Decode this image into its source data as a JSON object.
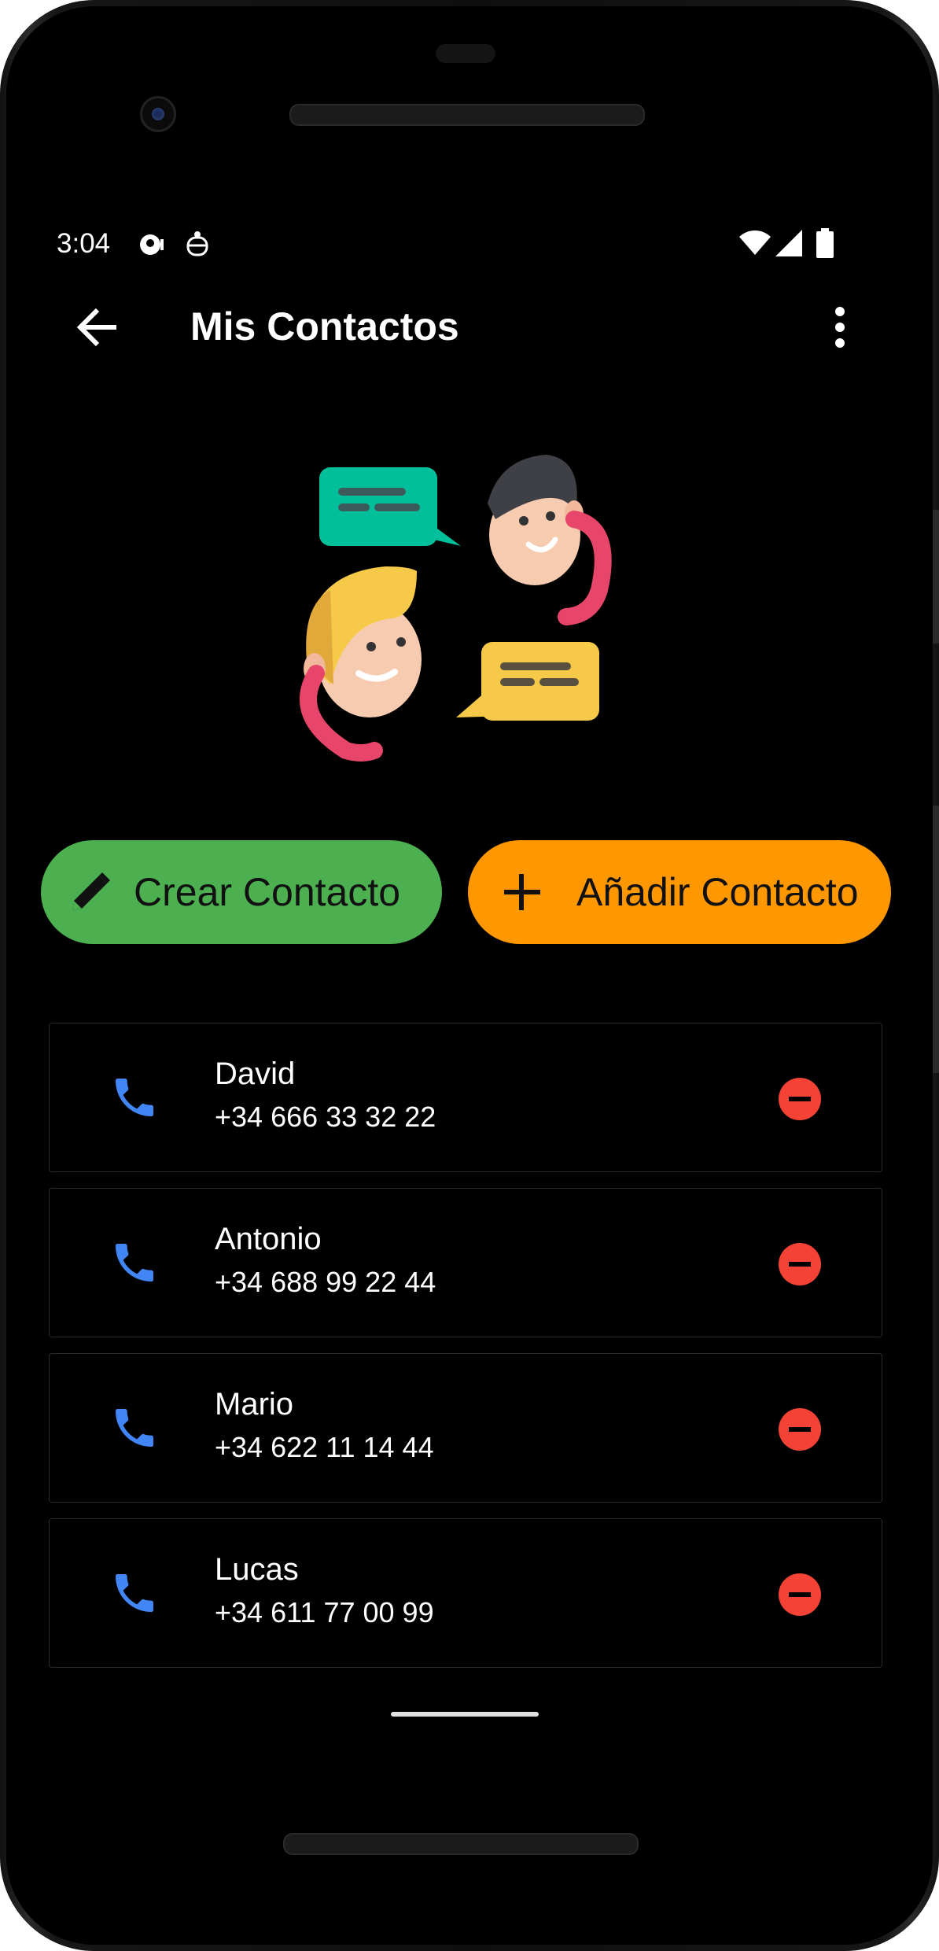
{
  "status_bar": {
    "time": "3:04"
  },
  "app_bar": {
    "title": "Mis Contactos"
  },
  "actions": {
    "create_label": "Crear Contacto",
    "add_label": "Añadir Contacto"
  },
  "contacts": [
    {
      "name": "David",
      "phone": "+34 666 33 32 22"
    },
    {
      "name": "Antonio",
      "phone": "+34 688 99 22 44"
    },
    {
      "name": "Mario",
      "phone": "+34 622 11 14 44"
    },
    {
      "name": "Lucas",
      "phone": "+34 611 77 00 99"
    }
  ],
  "icons": {
    "back": "arrow-left-icon",
    "menu": "more-vert-icon",
    "create": "pencil-icon",
    "add": "plus-icon",
    "call": "phone-icon",
    "remove": "remove-circle-icon",
    "wifi": "wifi-icon",
    "signal": "signal-icon",
    "battery": "battery-icon"
  },
  "colors": {
    "background": "#000000",
    "create_button": "#4caf50",
    "add_button": "#ff9800",
    "call_icon": "#4285f4",
    "remove_icon": "#f44336",
    "text": "#ffffff"
  }
}
